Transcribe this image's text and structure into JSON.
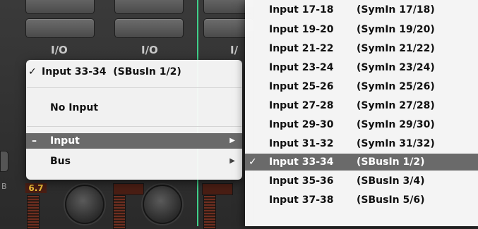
{
  "mixer": {
    "io_labels": [
      "I/O",
      "I/O",
      "I/"
    ],
    "meter_value": "6.7",
    "edge_letter": "B"
  },
  "context_menu": {
    "items": [
      {
        "check": "✓",
        "label": "Input 33-34  (SBusIn 1/2)"
      },
      {
        "check": "",
        "label": "No Input"
      },
      {
        "check": "–",
        "label": "Input",
        "submenu": true,
        "highlighted": true
      },
      {
        "check": "",
        "label": "Bus",
        "submenu": true
      }
    ],
    "submenu_arrow": "▶"
  },
  "input_submenu": {
    "items": [
      {
        "check": "",
        "input": "Input 17-18",
        "source": "(SymIn 17/18)"
      },
      {
        "check": "",
        "input": "Input 19-20",
        "source": "(SymIn 19/20)"
      },
      {
        "check": "",
        "input": "Input 21-22",
        "source": "(SymIn 21/22)"
      },
      {
        "check": "",
        "input": "Input 23-24",
        "source": "(SymIn 23/24)"
      },
      {
        "check": "",
        "input": "Input 25-26",
        "source": "(SymIn 25/26)"
      },
      {
        "check": "",
        "input": "Input 27-28",
        "source": "(SymIn 27/28)"
      },
      {
        "check": "",
        "input": "Input 29-30",
        "source": "(SymIn 29/30)"
      },
      {
        "check": "",
        "input": "Input 31-32",
        "source": "(SymIn 31/32)"
      },
      {
        "check": "✓",
        "input": "Input 33-34",
        "source": "(SBusIn 1/2)",
        "selected": true
      },
      {
        "check": "",
        "input": "Input 35-36",
        "source": "(SBusIn 3/4)"
      },
      {
        "check": "",
        "input": "Input 37-38",
        "source": "(SBusIn 5/6)"
      }
    ]
  },
  "colors": {
    "highlight": "#6a6a6a",
    "meter_value_text": "#f3c23a",
    "channel_accent": "#3fd08a"
  }
}
